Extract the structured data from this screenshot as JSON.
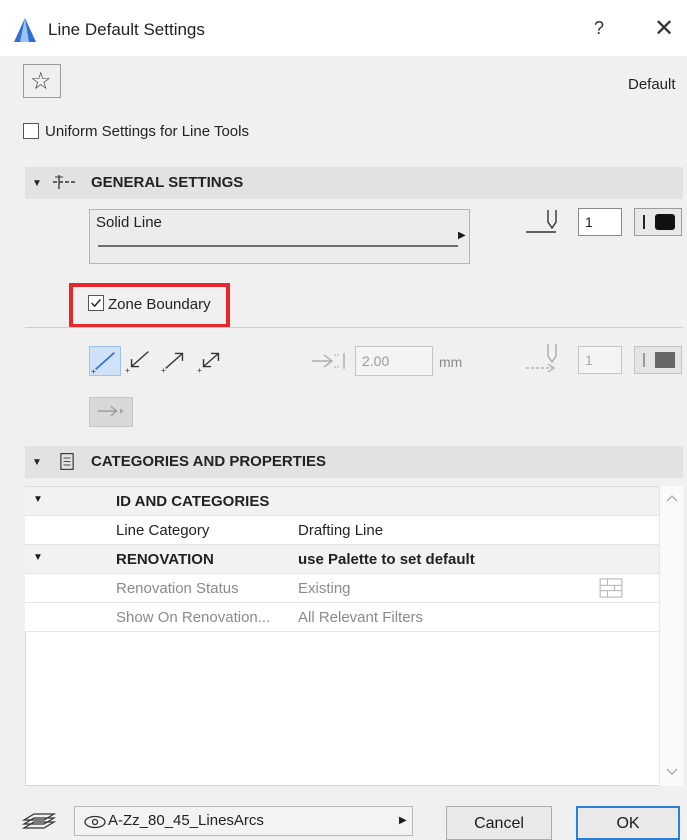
{
  "window": {
    "title": "Line Default Settings",
    "help": "?",
    "close": "✕"
  },
  "favorites": {
    "star_glyph": "☆",
    "default_label": "Default"
  },
  "uniform": {
    "label": "Uniform Settings for Line Tools",
    "checked": false
  },
  "general": {
    "arrow": "▼",
    "title": "GENERAL SETTINGS",
    "line_type": "Solid Line",
    "pen_number": "1",
    "zone_boundary_label": "Zone Boundary",
    "zone_boundary_checked": true,
    "arrowhead_size": "2.00",
    "unit": "mm",
    "arrow_pen_number": "1"
  },
  "categories": {
    "arrow": "▼",
    "title": "CATEGORIES AND PROPERTIES",
    "rows": [
      {
        "arrow": "▼",
        "key": "ID AND CATEGORIES",
        "value": ""
      },
      {
        "arrow": "",
        "key": "Line Category",
        "value": "Drafting Line"
      },
      {
        "arrow": "▼",
        "key": "RENOVATION",
        "value": "use Palette to set default"
      },
      {
        "arrow": "",
        "key": "Renovation Status",
        "value": "Existing"
      },
      {
        "arrow": "",
        "key": "Show On Renovation...",
        "value": "All Relevant Filters"
      }
    ]
  },
  "footer": {
    "layer": "A-Zz_80_45_LinesArcs",
    "cancel": "Cancel",
    "ok": "OK"
  },
  "colors": {
    "highlight": "#e8262b",
    "accent": "#2b7fd6",
    "icon_blue": "#2f6fd1"
  }
}
